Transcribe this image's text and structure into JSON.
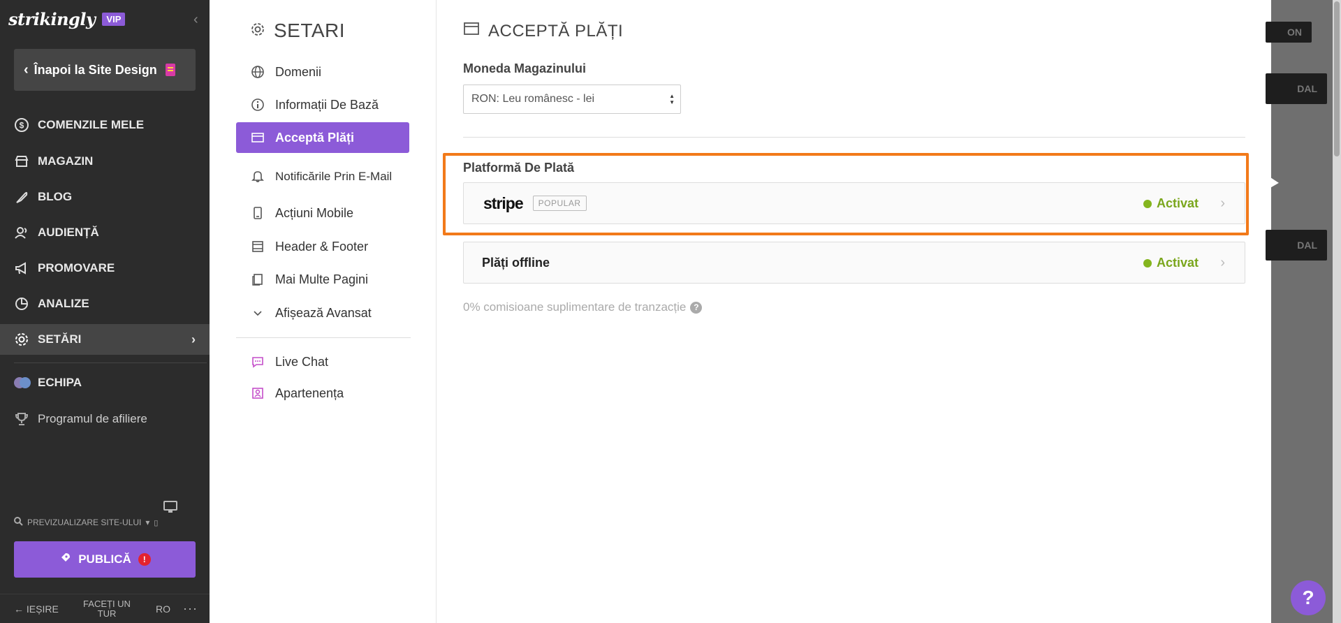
{
  "brand": {
    "logo": "strikingly",
    "badge": "VIP",
    "collapse_icon": "chevron-left-icon"
  },
  "sidebar": {
    "back_label": "Înapoi la Site Design",
    "items": [
      {
        "label": "COMENZILE MELE",
        "icon": "dollar-circle-icon"
      },
      {
        "label": "MAGAZIN",
        "icon": "store-icon"
      },
      {
        "label": "BLOG",
        "icon": "feather-icon"
      },
      {
        "label": "AUDIENȚĂ",
        "icon": "users-icon"
      },
      {
        "label": "PROMOVARE",
        "icon": "megaphone-icon"
      },
      {
        "label": "ANALIZE",
        "icon": "pie-chart-icon"
      },
      {
        "label": "SETĂRI",
        "icon": "gear-icon",
        "active": true
      },
      {
        "label": "ECHIPA",
        "icon": "team-avatars-icon"
      },
      {
        "label": "Programul de afiliere",
        "icon": "trophy-icon"
      }
    ],
    "preview_label": "PREVIZUALIZARE SITE-ULUI",
    "publish_label": "PUBLICĂ",
    "publish_alert": "!",
    "footer": {
      "exit": "IEȘIRE",
      "tour": "FACEȚI UN TUR",
      "lang": "RO",
      "more": "···"
    }
  },
  "settings_nav": {
    "title": "SETARI",
    "items": [
      {
        "label": "Domenii",
        "icon": "globe-icon"
      },
      {
        "label": "Informații De Bază",
        "icon": "info-icon"
      },
      {
        "label": "Acceptă Plăți",
        "icon": "credit-card-icon",
        "active": true
      },
      {
        "label": "Notificările Prin E-Mail",
        "icon": "bell-icon"
      },
      {
        "label": "Acțiuni Mobile",
        "icon": "mobile-icon"
      },
      {
        "label": "Header & Footer",
        "icon": "layout-icon"
      },
      {
        "label": "Mai Multe Pagini",
        "icon": "pages-icon"
      },
      {
        "label": "Afișează Avansat",
        "icon": "chevron-down-icon"
      }
    ],
    "extras": [
      {
        "label": "Live Chat",
        "icon": "chat-icon"
      },
      {
        "label": "Apartenența",
        "icon": "member-icon"
      }
    ]
  },
  "content": {
    "title": "ACCEPTĂ PLĂȚI",
    "currency_label": "Moneda Magazinului",
    "currency_value": "RON: Leu românesc - lei",
    "platform_label": "Platformă De Plată",
    "stripe": {
      "name": "stripe",
      "badge": "POPULAR",
      "status": "Activat"
    },
    "offline": {
      "name": "Plăți offline",
      "status": "Activat"
    },
    "fee_note": "0% comisioane suplimentare de tranzacție",
    "highlight_color": "#f27a1a",
    "status_color": "#84b51e"
  },
  "overlay": {
    "buttons": [
      "ON",
      "DAL",
      "DAL"
    ],
    "help_label": "?"
  }
}
